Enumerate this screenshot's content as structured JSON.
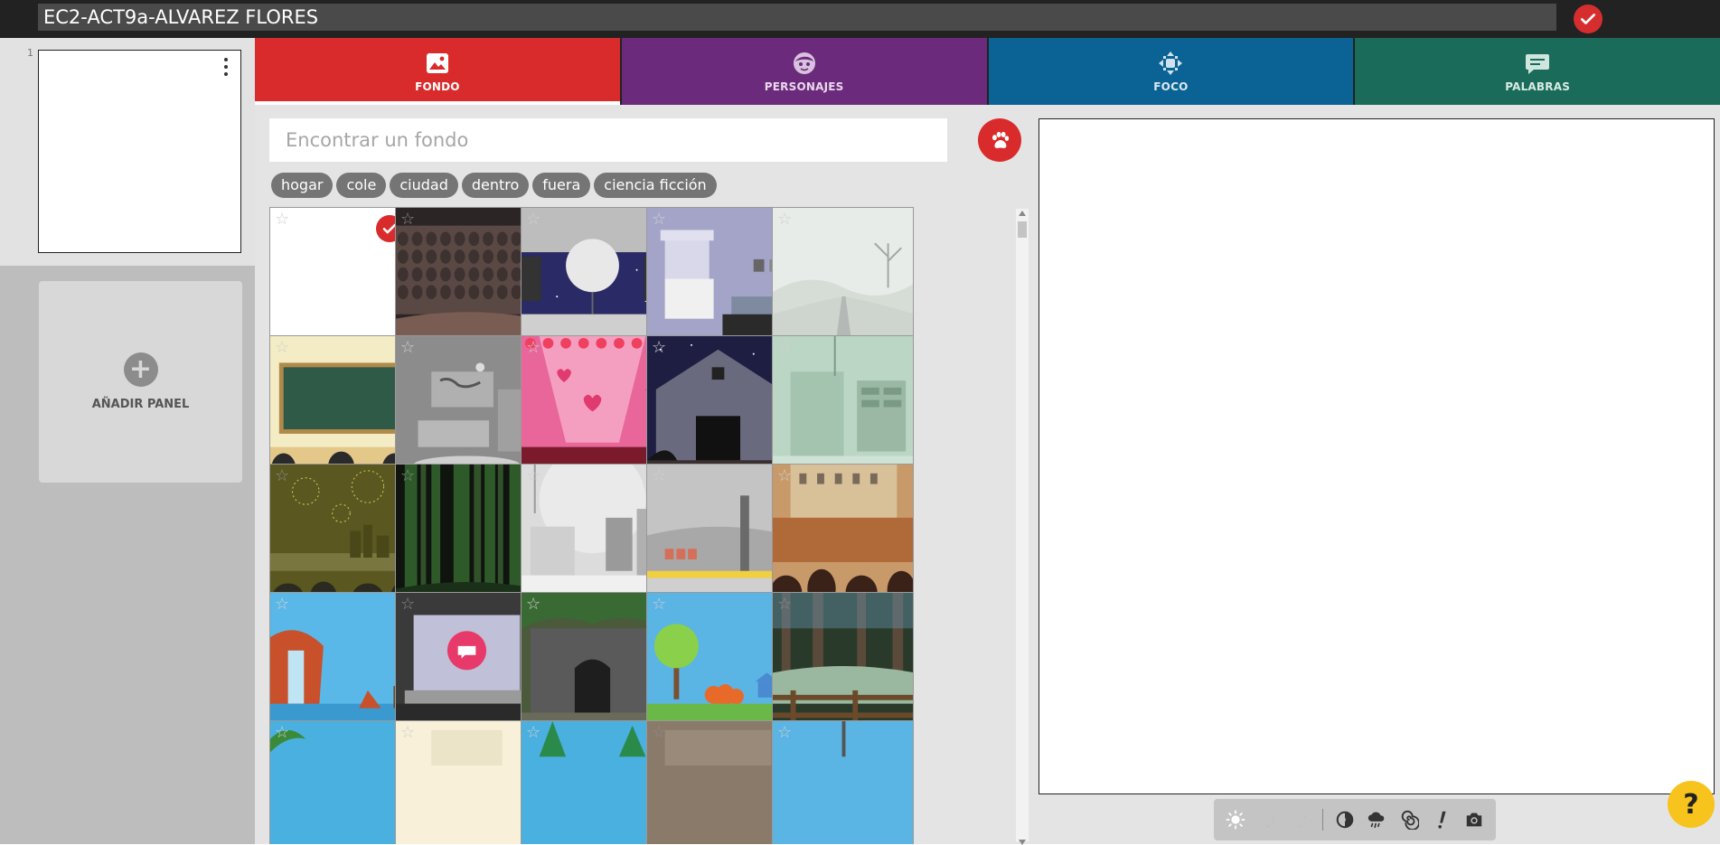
{
  "header": {
    "title_value": "EC2-ACT9a-ALVAREZ FLORES",
    "confirm_icon": "check-icon"
  },
  "panels": {
    "items": [
      {
        "number": "1"
      }
    ],
    "add_label": "AÑADIR PANEL"
  },
  "tabs": [
    {
      "label": "FONDO",
      "icon": "image-icon",
      "color": "#d92b2b",
      "active": true
    },
    {
      "label": "PERSONAJES",
      "icon": "face-icon",
      "color": "#6b2a7b",
      "active": false
    },
    {
      "label": "FOCO",
      "icon": "move-icon",
      "color": "#0a6394",
      "active": false
    },
    {
      "label": "PALABRAS",
      "icon": "speech-bubble-icon",
      "color": "#1b6b5a",
      "active": false
    }
  ],
  "search": {
    "placeholder": "Encontrar un fondo",
    "value": "",
    "paw_icon": "paw-icon"
  },
  "chips": [
    "hogar",
    "cole",
    "ciudad",
    "dentro",
    "fuera",
    "ciencia ficción"
  ],
  "backgrounds": [
    {
      "name": "blank",
      "selected": true,
      "star": "light"
    },
    {
      "name": "theater-audience",
      "selected": false,
      "star": "dark"
    },
    {
      "name": "space-station-window",
      "selected": false,
      "star": "light"
    },
    {
      "name": "living-room",
      "selected": false,
      "star": "light"
    },
    {
      "name": "foggy-road",
      "selected": false,
      "star": "light"
    },
    {
      "name": "classroom",
      "selected": false,
      "star": "light"
    },
    {
      "name": "office",
      "selected": false,
      "star": "light"
    },
    {
      "name": "valentine-stage",
      "selected": false,
      "star": "light"
    },
    {
      "name": "barn-night",
      "selected": false,
      "star": "light"
    },
    {
      "name": "lab-corridor",
      "selected": false,
      "star": "light"
    },
    {
      "name": "fireworks-city",
      "selected": false,
      "star": "dark"
    },
    {
      "name": "night-forest",
      "selected": false,
      "star": "dark"
    },
    {
      "name": "hospital-room",
      "selected": false,
      "star": "light"
    },
    {
      "name": "subway-platform",
      "selected": false,
      "star": "light"
    },
    {
      "name": "stadium-crowd",
      "selected": false,
      "star": "light"
    },
    {
      "name": "waterfall",
      "selected": false,
      "star": "light"
    },
    {
      "name": "laptop-chat",
      "selected": false,
      "star": "dark"
    },
    {
      "name": "stone-cave",
      "selected": false,
      "star": "light"
    },
    {
      "name": "park-tree",
      "selected": false,
      "star": "light"
    },
    {
      "name": "swamp-fence",
      "selected": false,
      "star": "dark"
    },
    {
      "name": "jungle-beach",
      "selected": false,
      "star": "light"
    },
    {
      "name": "cream-room",
      "selected": false,
      "star": "light"
    },
    {
      "name": "pine-forest",
      "selected": false,
      "star": "light"
    },
    {
      "name": "brown-interior",
      "selected": false,
      "star": "dark"
    },
    {
      "name": "blue-sky-pole",
      "selected": false,
      "star": "light"
    }
  ],
  "toolbar": [
    {
      "icon": "sun-icon"
    },
    {
      "icon": "moon-icon"
    },
    {
      "icon": "crescent-icon"
    },
    {
      "icon": "color-filter-icon"
    },
    {
      "icon": "rain-icon"
    },
    {
      "icon": "spiral-icon"
    },
    {
      "icon": "exclamation-icon"
    },
    {
      "icon": "camera-icon"
    }
  ],
  "help": {
    "label": "?"
  }
}
